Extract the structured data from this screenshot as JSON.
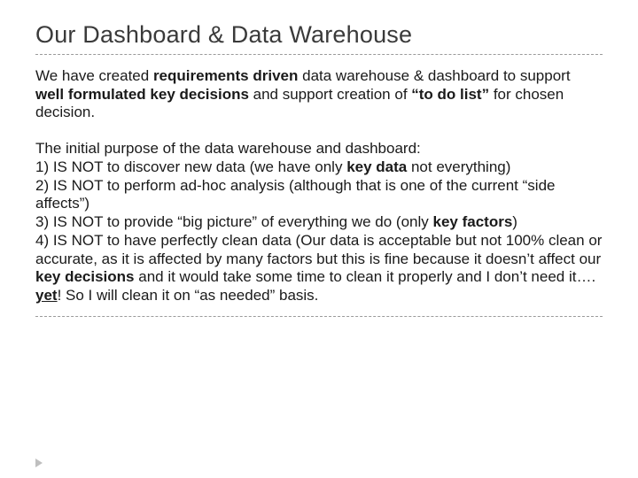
{
  "title": "Our Dashboard & Data Warehouse",
  "intro": {
    "t1": "We have created ",
    "b1": "requirements driven",
    "t2": " data warehouse & dashboard to support ",
    "b2": "well formulated key decisions",
    "t3": " and support creation of ",
    "b3": "“to do list”",
    "t4": " for chosen decision."
  },
  "purpose_lead": "The initial purpose of the data warehouse and dashboard:",
  "p1": {
    "a": "1) IS NOT to discover new data (we have only ",
    "b": "key data",
    "c": " not everything)"
  },
  "p2": "2) IS NOT to perform ad-hoc analysis (although that is one of the current “side affects”)",
  "p3": {
    "a": "3) IS NOT to provide “big picture” of everything we do (only ",
    "b": "key factors",
    "c": ")"
  },
  "p4": {
    "a": "4) IS NOT to have perfectly clean data (Our data is acceptable but not 100% clean or accurate, as it is affected by many factors but this is fine because it doesn’t affect our ",
    "b": "key decisions",
    "c": " and it would take some time to clean it properly and I don’t need it…. ",
    "d": "yet",
    "e": "! So I will clean it on “as needed” basis."
  }
}
